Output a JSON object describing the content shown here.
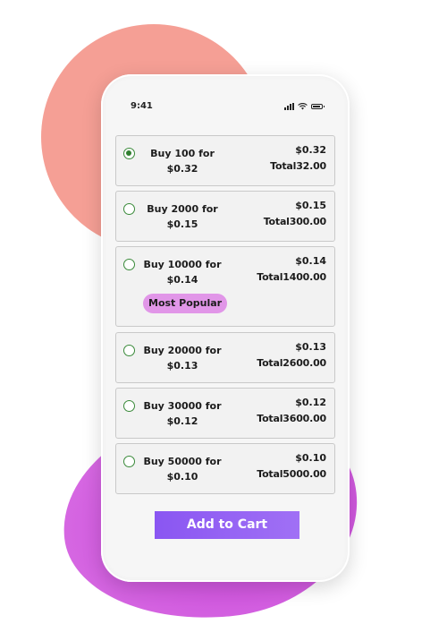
{
  "status_bar": {
    "time": "9:41"
  },
  "colors": {
    "accent": "#8a56f2",
    "badge": "#e196e8",
    "selected_radio": "#2f7f2f",
    "blob_coral": "#f59f95",
    "blob_purple": "#c64cd8"
  },
  "offers": [
    {
      "title_line1": "Buy 100 for",
      "title_line2": "$0.32",
      "price": "$0.32",
      "total": "Total32.00",
      "selected": true,
      "badge": ""
    },
    {
      "title_line1": "Buy 2000 for",
      "title_line2": "$0.15",
      "price": "$0.15",
      "total": "Total300.00",
      "selected": false,
      "badge": ""
    },
    {
      "title_line1": "Buy 10000 for",
      "title_line2": "$0.14",
      "price": "$0.14",
      "total": "Total1400.00",
      "selected": false,
      "badge": "Most Popular"
    },
    {
      "title_line1": "Buy 20000 for",
      "title_line2": "$0.13",
      "price": "$0.13",
      "total": "Total2600.00",
      "selected": false,
      "badge": ""
    },
    {
      "title_line1": "Buy 30000 for",
      "title_line2": "$0.12",
      "price": "$0.12",
      "total": "Total3600.00",
      "selected": false,
      "badge": ""
    },
    {
      "title_line1": "Buy 50000 for",
      "title_line2": "$0.10",
      "price": "$0.10",
      "total": "Total5000.00",
      "selected": false,
      "badge": ""
    }
  ],
  "cart_button_label": "Add to Cart"
}
